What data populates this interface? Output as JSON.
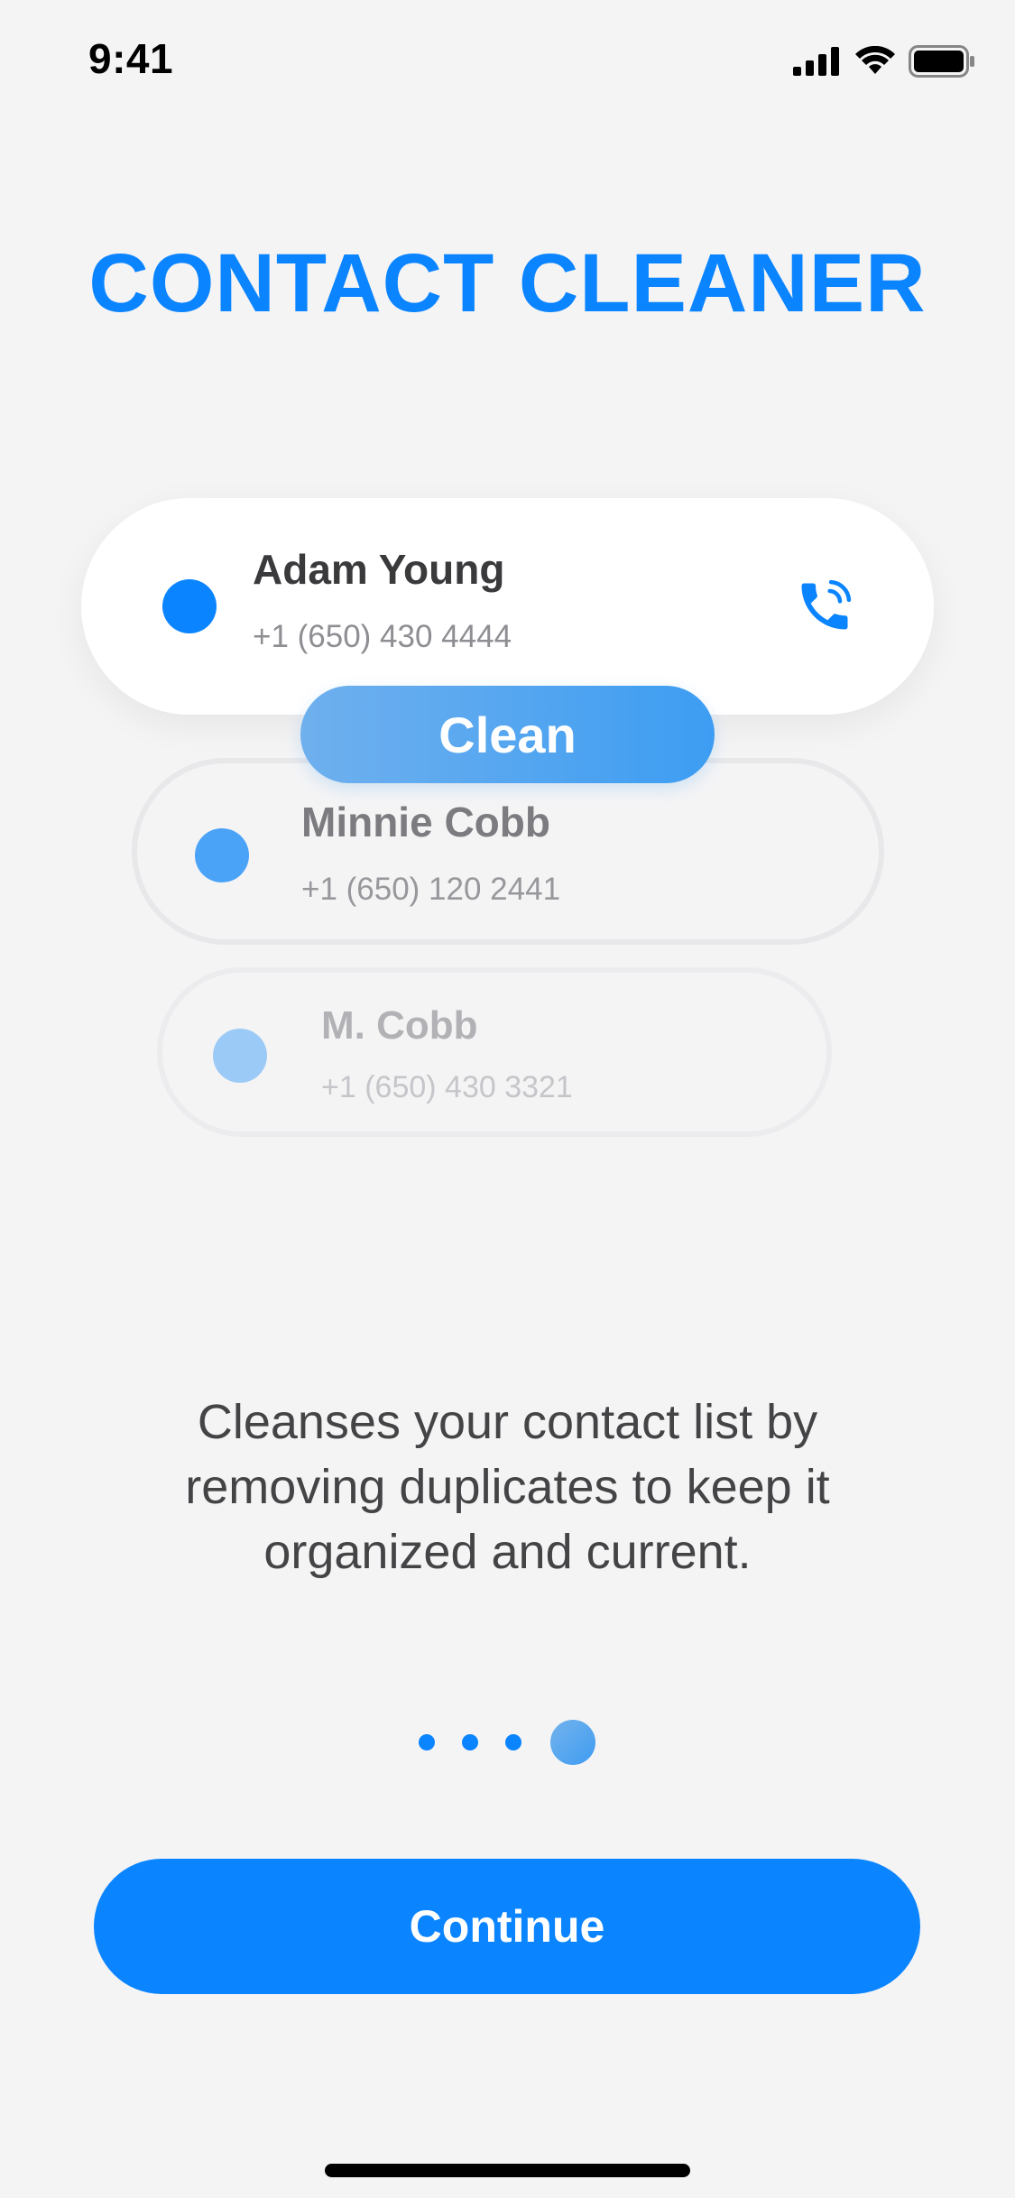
{
  "status_bar": {
    "time": "9:41",
    "icons": [
      "cellular-signal-icon",
      "wifi-icon",
      "battery-icon"
    ]
  },
  "title": "CONTACT CLEANER",
  "contacts": [
    {
      "name": "Adam Young",
      "phone": "+1 (650) 430 4444",
      "dot_color": "#0a84ff",
      "icon": "phone-call-icon"
    },
    {
      "name": "Minnie Cobb",
      "phone": "+1 (650) 120 2441",
      "dot_color": "#4aa3f7"
    },
    {
      "name": "M. Cobb",
      "phone": "+1 (650) 430 3321",
      "dot_color": "#9ccaf7"
    }
  ],
  "clean_button_label": "Clean",
  "description": "Cleanses your contact list by removing duplicates to keep it organized and current.",
  "pager": {
    "count": 4,
    "active_index": 3
  },
  "continue_label": "Continue",
  "colors": {
    "accent": "#0a84ff",
    "background": "#f4f4f5"
  }
}
